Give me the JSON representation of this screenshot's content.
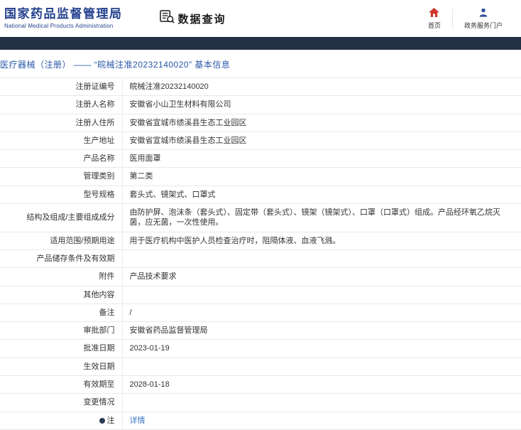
{
  "header": {
    "agency_name_cn": "国家药品监督管理局",
    "agency_name_en": "National Medical Products Administration",
    "section_title": "数据查询",
    "nav": [
      {
        "label": "首页",
        "icon": "home-icon"
      },
      {
        "label": "政务服务门户",
        "icon": "person-icon"
      }
    ]
  },
  "title_bar": {
    "text": "医疗器械（注册） —— “皖械注准20232140020” 基本信息"
  },
  "table": {
    "rows": [
      {
        "label": "注册证编号",
        "value": "皖械注准20232140020"
      },
      {
        "label": "注册人名称",
        "value": "安徽省小山卫生材料有限公司"
      },
      {
        "label": "注册人住所",
        "value": "安徽省宣城市绩溪县生态工业园区"
      },
      {
        "label": "生产地址",
        "value": "安徽省宣城市绩溪县生态工业园区"
      },
      {
        "label": "产品名称",
        "value": "医用面罩"
      },
      {
        "label": "管理类别",
        "value": "第二类"
      },
      {
        "label": "型号规格",
        "value": "套头式、镜架式、口罩式"
      },
      {
        "label": "结构及组成/主要组成成分",
        "value": "由防护屏、泡沫条（套头式）、固定带（套头式）、镜架（镜架式）、口罩（口罩式）组成。产品经环氧乙烷灭菌，应无菌，一次性使用。"
      },
      {
        "label": "适用范围/预期用途",
        "value": "用于医疗机构中医护人员检查治疗时，阻隔体液、血液飞溅。"
      },
      {
        "label": "产品储存条件及有效期",
        "value": ""
      },
      {
        "label": "附件",
        "value": "产品技术要求"
      },
      {
        "label": "其他内容",
        "value": ""
      },
      {
        "label": "备注",
        "value": "/"
      },
      {
        "label": "审批部门",
        "value": "安徽省药品监督管理局"
      },
      {
        "label": "批准日期",
        "value": "2023-01-19"
      },
      {
        "label": "生效日期",
        "value": ""
      },
      {
        "label": "有效期至",
        "value": "2028-01-18"
      },
      {
        "label": "变更情况",
        "value": ""
      },
      {
        "label": "注",
        "value": "详情",
        "bullet": true,
        "link": true
      }
    ]
  },
  "icons": {
    "query": "document-search-icon",
    "home": "home-icon",
    "portal": "person-icon",
    "note": "note-bullet-icon"
  },
  "colors": {
    "logo_blue": "#24418e",
    "navbar_navy": "#232f45",
    "title_blue": "#2656a8",
    "link_blue": "#3a76c4",
    "home_icon_red": "#d0342c",
    "person_icon_blue": "#2b4ea0",
    "border_gray": "#e9e9e9"
  }
}
